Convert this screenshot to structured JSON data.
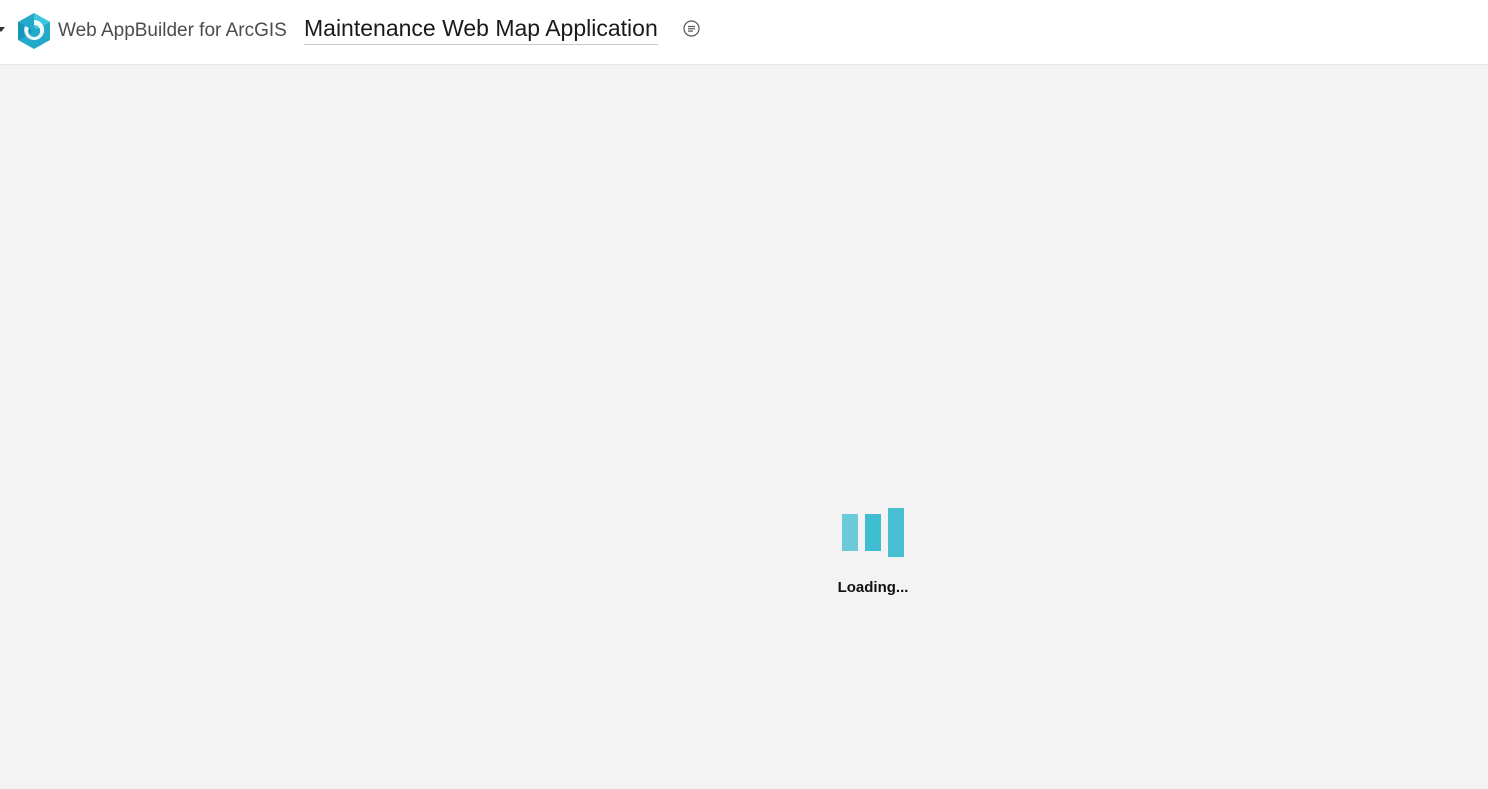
{
  "header": {
    "brand": "Web AppBuilder for ArcGIS",
    "app_title": "Maintenance Web Map Application",
    "logo_icon": "web-appbuilder-logo-icon",
    "title_info_icon": "info-lines-icon"
  },
  "main": {
    "loading_text": "Loading...",
    "loader_icon": "loading-bars-icon"
  },
  "colors": {
    "brand_accent": "#3fbdd1",
    "background": "#f3f3f3",
    "header_bg": "#ffffff"
  }
}
